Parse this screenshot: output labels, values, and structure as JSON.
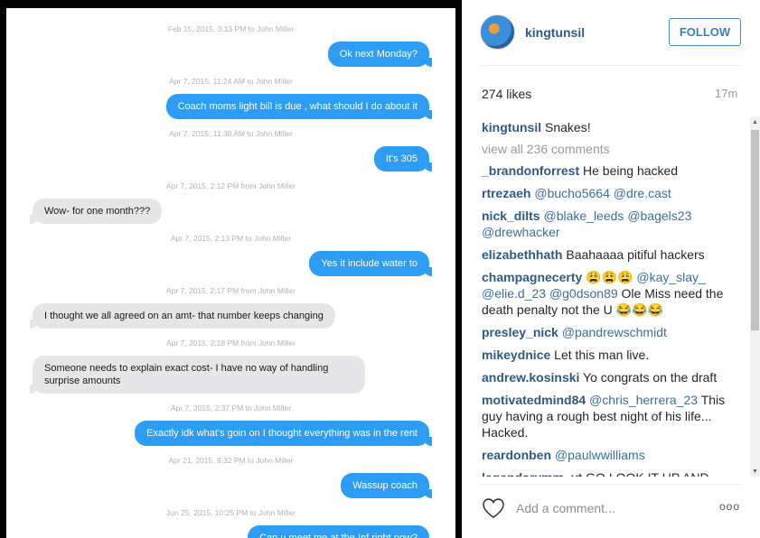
{
  "messages": [
    {
      "timestamp": "Feb 15, 2015, 3:13 PM to John Miller",
      "text": "Ok next Monday?",
      "dir": "sent"
    },
    {
      "timestamp": "Apr 7, 2015, 11:24 AM to John Miller",
      "text": "Coach moms light bill is due , what should I do about it",
      "dir": "sent"
    },
    {
      "timestamp": "Apr 7, 2015, 11:30 AM to John Miller",
      "text": "It's 305",
      "dir": "sent"
    },
    {
      "timestamp": "Apr 7, 2015, 2:12 PM from John Miller",
      "text": "Wow- for one month???",
      "dir": "recv"
    },
    {
      "timestamp": "Apr 7, 2015, 2:13 PM to John Miller",
      "text": "Yes it include water to",
      "dir": "sent"
    },
    {
      "timestamp": "Apr 7, 2015, 2:17 PM from John Miller",
      "text": "I thought we all agreed on an amt- that number keeps changing",
      "dir": "recv"
    },
    {
      "timestamp": "Apr 7, 2015, 2:18 PM from John Miller",
      "text": "Someone needs to explain exact cost- I have no way of handling surprise amounts",
      "dir": "recv"
    },
    {
      "timestamp": "Apr 7, 2015, 2:37 PM to John Miller",
      "text": "Exactly idk what's goin on I thought everything was in the rent",
      "dir": "sent"
    },
    {
      "timestamp": "Apr 21, 2015, 9:32 PM to John Miller",
      "text": "Wassup coach",
      "dir": "sent"
    },
    {
      "timestamp": "Jun 25, 2015, 10:25 PM to John Miller",
      "text": "Can u meet me at the Inf right now?",
      "dir": "sent"
    }
  ],
  "post": {
    "username": "kingtunsil",
    "follow_label": "FOLLOW",
    "likes": "274 likes",
    "time_ago": "17m",
    "caption": "Snakes!",
    "view_all": "view all 236 comments",
    "add_comment_placeholder": "Add a comment...",
    "more": "ooo"
  },
  "comments": [
    {
      "user": "_brandonforrest",
      "parts": [
        {
          "t": "He being hacked"
        }
      ]
    },
    {
      "user": "rtrezaeh",
      "parts": [
        {
          "t": "@bucho5664",
          "m": true
        },
        {
          "t": " "
        },
        {
          "t": "@dre.cast",
          "m": true
        }
      ]
    },
    {
      "user": "nick_dilts",
      "parts": [
        {
          "t": "@blake_leeds",
          "m": true
        },
        {
          "t": " "
        },
        {
          "t": "@bagels23",
          "m": true
        },
        {
          "t": " "
        },
        {
          "t": "@drewhacker",
          "m": true
        }
      ]
    },
    {
      "user": "elizabethhath",
      "parts": [
        {
          "t": "Baahaaaa pitiful hackers"
        }
      ]
    },
    {
      "user": "champagnecerty",
      "parts": [
        {
          "t": "😩😩😩 "
        },
        {
          "t": "@kay_slay_",
          "m": true
        },
        {
          "t": " "
        },
        {
          "t": "@elie.d_23",
          "m": true
        },
        {
          "t": " "
        },
        {
          "t": "@g0dson89",
          "m": true
        },
        {
          "t": " Ole Miss need the death penalty not the U 😂😂😂"
        }
      ]
    },
    {
      "user": "presley_nick",
      "parts": [
        {
          "t": "@pandrewschmidt",
          "m": true
        }
      ]
    },
    {
      "user": "mikeydnice",
      "parts": [
        {
          "t": "Let this man live."
        }
      ]
    },
    {
      "user": "andrew.kosinski",
      "parts": [
        {
          "t": "Yo congrats on the draft"
        }
      ]
    },
    {
      "user": "motivatedmind84",
      "parts": [
        {
          "t": "@chris_herrera_23",
          "m": true
        },
        {
          "t": " This guy having a rough best night of his life... Hacked."
        }
      ]
    },
    {
      "user": "reardonben",
      "parts": [
        {
          "t": "@paulwwilliams",
          "m": true
        }
      ]
    },
    {
      "user": "legendarymm_yt",
      "parts": [
        {
          "t": "GO LOOK IT UP AND"
        }
      ]
    }
  ],
  "colors": {
    "sent_bubble": "#2d9cf5",
    "recv_bubble": "#e6e6e8",
    "username": "#2e5a86",
    "follow": "#3b7cc7"
  },
  "icons": {
    "heart": "heart-icon",
    "avatar": "avatar"
  }
}
